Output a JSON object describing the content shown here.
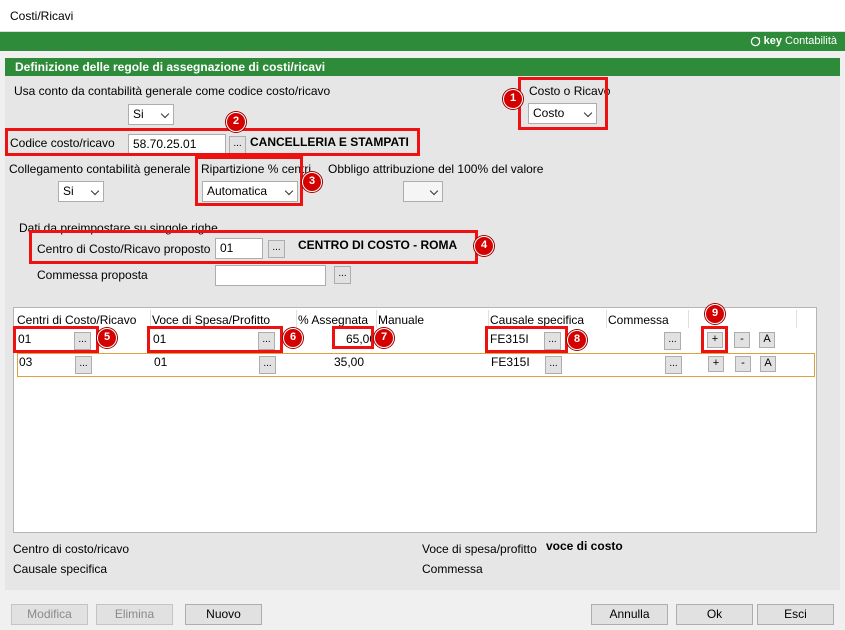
{
  "window": {
    "title": "Costi/Ricavi"
  },
  "brand": {
    "key": "key",
    "name": "Contabilità"
  },
  "section": {
    "title": "Definizione delle regole di assegnazione di costi/ricavi"
  },
  "form": {
    "usa_conto_label": "Usa conto da contabilità generale come codice costo/ricavo",
    "usa_conto_value": "Si",
    "costo_ricavo_label": "Costo o Ricavo",
    "costo_ricavo_value": "Costo",
    "codice_label": "Codice costo/ricavo",
    "codice_value": "58.70.25.01",
    "codice_desc": "CANCELLERIA E STAMPATI",
    "collegamento_label": "Collegamento contabilità generale",
    "collegamento_value": "Si",
    "ripartizione_label": "Ripartizione % centri",
    "ripartizione_value": "Automatica",
    "obbligo_label": "Obbligo attribuzione del 100% del valore",
    "obbligo_value": "",
    "dati_label": "Dati da preimpostare su singole righe",
    "centro_label": "Centro di Costo/Ricavo proposto",
    "centro_value": "01",
    "centro_desc": "CENTRO DI COSTO - ROMA",
    "commessa_label": "Commessa proposta",
    "commessa_value": ""
  },
  "grid": {
    "headers": [
      "Centri di Costo/Ricavo",
      "Voce di Spesa/Profitto",
      "% Assegnata",
      "Manuale",
      "Causale specifica",
      "Commessa"
    ],
    "rows": [
      {
        "centro": "01",
        "voce": "01",
        "perc": "65,00",
        "causale": "FE315I"
      },
      {
        "centro": "03",
        "voce": "01",
        "perc": "35,00",
        "causale": "FE315I"
      }
    ],
    "dots": "...",
    "plus": "+",
    "minus": "-",
    "a": "A"
  },
  "footer": {
    "centro_label": "Centro di costo/ricavo",
    "causale_label": "Causale specifica",
    "voce_label": "Voce di spesa/profitto",
    "voce_value": "voce di costo",
    "commessa_label": "Commessa"
  },
  "buttons": {
    "modifica": "Modifica",
    "elimina": "Elimina",
    "nuovo": "Nuovo",
    "annulla": "Annulla",
    "ok": "Ok",
    "esci": "Esci"
  },
  "badges": [
    "1",
    "2",
    "3",
    "4",
    "5",
    "6",
    "7",
    "8",
    "9"
  ],
  "colors": {
    "green": "#2e8b3a",
    "red": "#e11111",
    "badge": "#d40000"
  }
}
